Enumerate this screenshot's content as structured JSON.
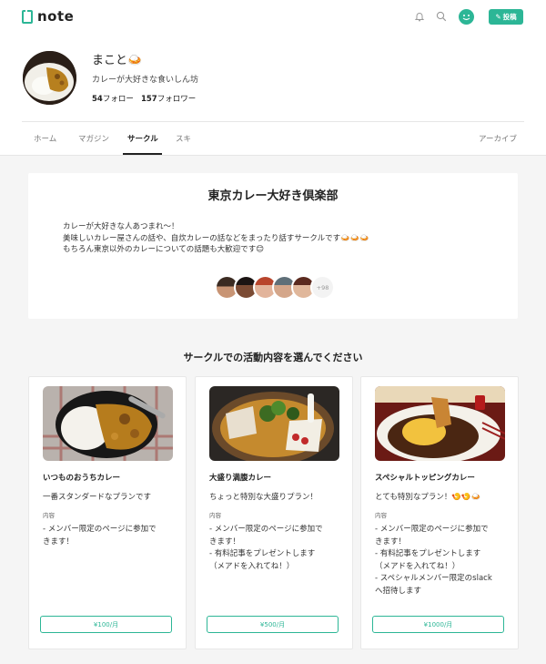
{
  "header": {
    "logo_text": "note",
    "post_label": "投稿",
    "colors": {
      "accent": "#2cb696"
    }
  },
  "profile": {
    "name": "まこと🍛",
    "bio": "カレーが大好きな食いしん坊",
    "follow_count": "54",
    "follow_label": "フォロー",
    "follower_count": "157",
    "follower_label": "フォロワー"
  },
  "tabs": [
    {
      "label": "ホーム"
    },
    {
      "label": "マガジン"
    },
    {
      "label": "サークル"
    },
    {
      "label": "スキ"
    },
    {
      "label": "アーカイブ"
    }
  ],
  "circle": {
    "title": "東京カレー大好き倶楽部",
    "description": [
      "カレーが大好きな人あつまれ〜！",
      "美味しいカレー屋さんの話や、自炊カレーの話などをまったり話すサークルです🍛🍛🍛",
      "もちろん東京以外のカレーについての話題も大歓迎です😊"
    ],
    "member_more": "+98"
  },
  "plans_heading": "サークルでの活動内容を選んでください",
  "plans": [
    {
      "name": "いつものおうちカレー",
      "subtitle": "一番スタンダードなプランです",
      "content_label": "内容",
      "description": [
        "- メンバー限定のページに参加で",
        "きます！"
      ],
      "price": "¥100/月"
    },
    {
      "name": "大盛り満腹カレー",
      "subtitle": "ちょっと特別な大盛りプラン！",
      "content_label": "内容",
      "description": [
        "- メンバー限定のページに参加で",
        "きます！",
        "- 有料記事をプレゼントします",
        "（メアドを入れてね！）"
      ],
      "price": "¥500/月"
    },
    {
      "name": "スペシャルトッピングカレー",
      "subtitle": "とても特別なプラン！🍤🍤🍛",
      "content_label": "内容",
      "description": [
        "- メンバー限定のページに参加で",
        "きます！",
        "- 有料記事をプレゼントします",
        "（メアドを入れてね！）",
        "- スペシャルメンバー限定のslack",
        "へ招待します"
      ],
      "price": "¥1000/月"
    }
  ]
}
